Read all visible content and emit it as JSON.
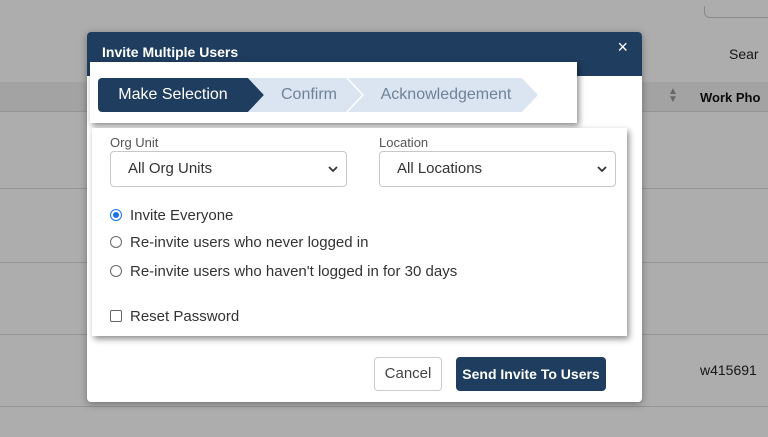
{
  "background": {
    "search_label": "Sear",
    "column_header": "Work Pho",
    "cell_value": "w415691"
  },
  "modal": {
    "title": "Invite Multiple Users",
    "close_glyph": "×"
  },
  "stepper": {
    "steps": [
      {
        "label": "Make Selection",
        "state": "active"
      },
      {
        "label": "Confirm",
        "state": "inactive"
      },
      {
        "label": "Acknowledgement",
        "state": "inactive"
      }
    ]
  },
  "form": {
    "org_unit": {
      "label": "Org Unit",
      "value": "All Org Units"
    },
    "location": {
      "label": "Location",
      "value": "All Locations"
    },
    "options": [
      {
        "label": "Invite Everyone",
        "checked": true
      },
      {
        "label": "Re-invite users who never logged in",
        "checked": false
      },
      {
        "label": "Re-invite users who haven't logged in for 30 days",
        "checked": false
      }
    ],
    "reset_password": {
      "label": "Reset Password",
      "checked": false
    }
  },
  "footer": {
    "cancel_label": "Cancel",
    "send_label": "Send Invite To Users"
  },
  "colors": {
    "primary": "#1f3d5f",
    "step_inactive": "#dbe5f1",
    "radio_accent": "#1a73e8"
  }
}
